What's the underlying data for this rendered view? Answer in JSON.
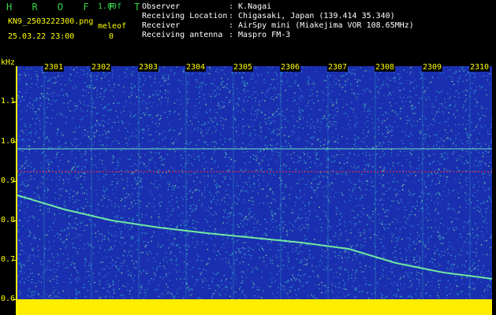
{
  "header": {
    "brand": "H R O F F T",
    "version": "1.00f",
    "filename": "KN9_2503222300.png",
    "datetime": "25.03.22 23:00",
    "meleof_label": "meleof",
    "meleof_value": "0",
    "fields": [
      {
        "label": "Observer",
        "value": ": K.Nagai"
      },
      {
        "label": "Receiving Location",
        "value": ": Chigasaki, Japan (139.414 35.340)"
      },
      {
        "label": "Receiver",
        "value": ": AirSpy mini (Miakejima VOR 108.65MHz)"
      },
      {
        "label": "Receiving antenna",
        "value": ": Maspro FM-3"
      }
    ]
  },
  "spectrogram": {
    "y_unit": "kHz",
    "y_ticks": [
      "1.1",
      "1.0",
      "0.9",
      "0.8",
      "0.7",
      "0.6"
    ],
    "time_ticks": [
      "2301",
      "2302",
      "2303",
      "2304",
      "2305",
      "2306",
      "2307",
      "2308",
      "2309",
      "2310"
    ],
    "colors": {
      "background": "#1a2fb0",
      "noise": "#2fb0c8",
      "carrier": "#ff3030",
      "baseline": "#ffee00"
    }
  }
}
